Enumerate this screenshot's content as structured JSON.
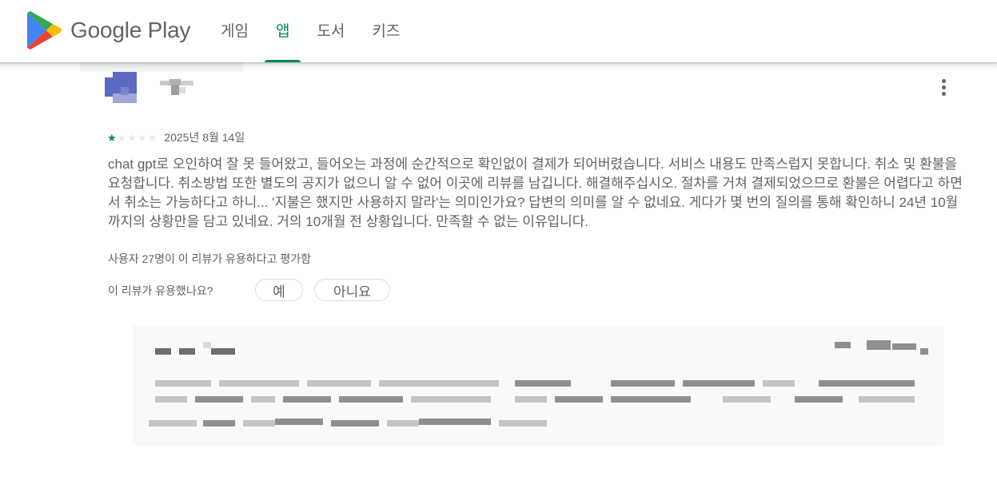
{
  "header": {
    "brand": "Google Play",
    "brand_colors": {
      "green": "#01875f",
      "blue": "#4285f4",
      "red": "#ea4335",
      "yellow": "#fbbc04"
    },
    "tabs": [
      {
        "label": "게임",
        "active": false
      },
      {
        "label": "앱",
        "active": true
      },
      {
        "label": "도서",
        "active": false
      },
      {
        "label": "키즈",
        "active": false
      }
    ],
    "accent_color": "#01875f"
  },
  "review": {
    "rating": 1,
    "rating_max": 5,
    "date": "2025년 8월 14일",
    "text": "chat gpt로 오인하여 잘 못 들어왔고, 들어오는 과정에 순간적으로 확인없이 결제가 되어버렸습니다. 서비스 내용도 만족스럽지 못합니다. 취소 및 환불을 요청합니다. 취소방법 또한 별도의 공지가 없으니 알 수 없어 이곳에 리뷰를 남깁니다. 해결해주십시오. 절차를 거쳐 결제되었으므로 환불은 어렵다고 하면서 취소는 가능하다고 하니... '지불은 했지만 사용하지 말라'는 의미인가요? 답변의 의미를 알 수 없네요. 게다가 몇 번의 질의를 통해 확인하니 24년 10월까지의 상황만을 담고 있네요. 거의 10개월 전 상황입니다. 만족할 수 없는 이유입니다.",
    "helpful_count": "사용자 27명이 이 리뷰가 유용하다고 평가함",
    "helpful_question": "이 리뷰가 유용했나요?",
    "yes_label": "예",
    "no_label": "아니요",
    "menu_icon": "more-vert-icon"
  }
}
